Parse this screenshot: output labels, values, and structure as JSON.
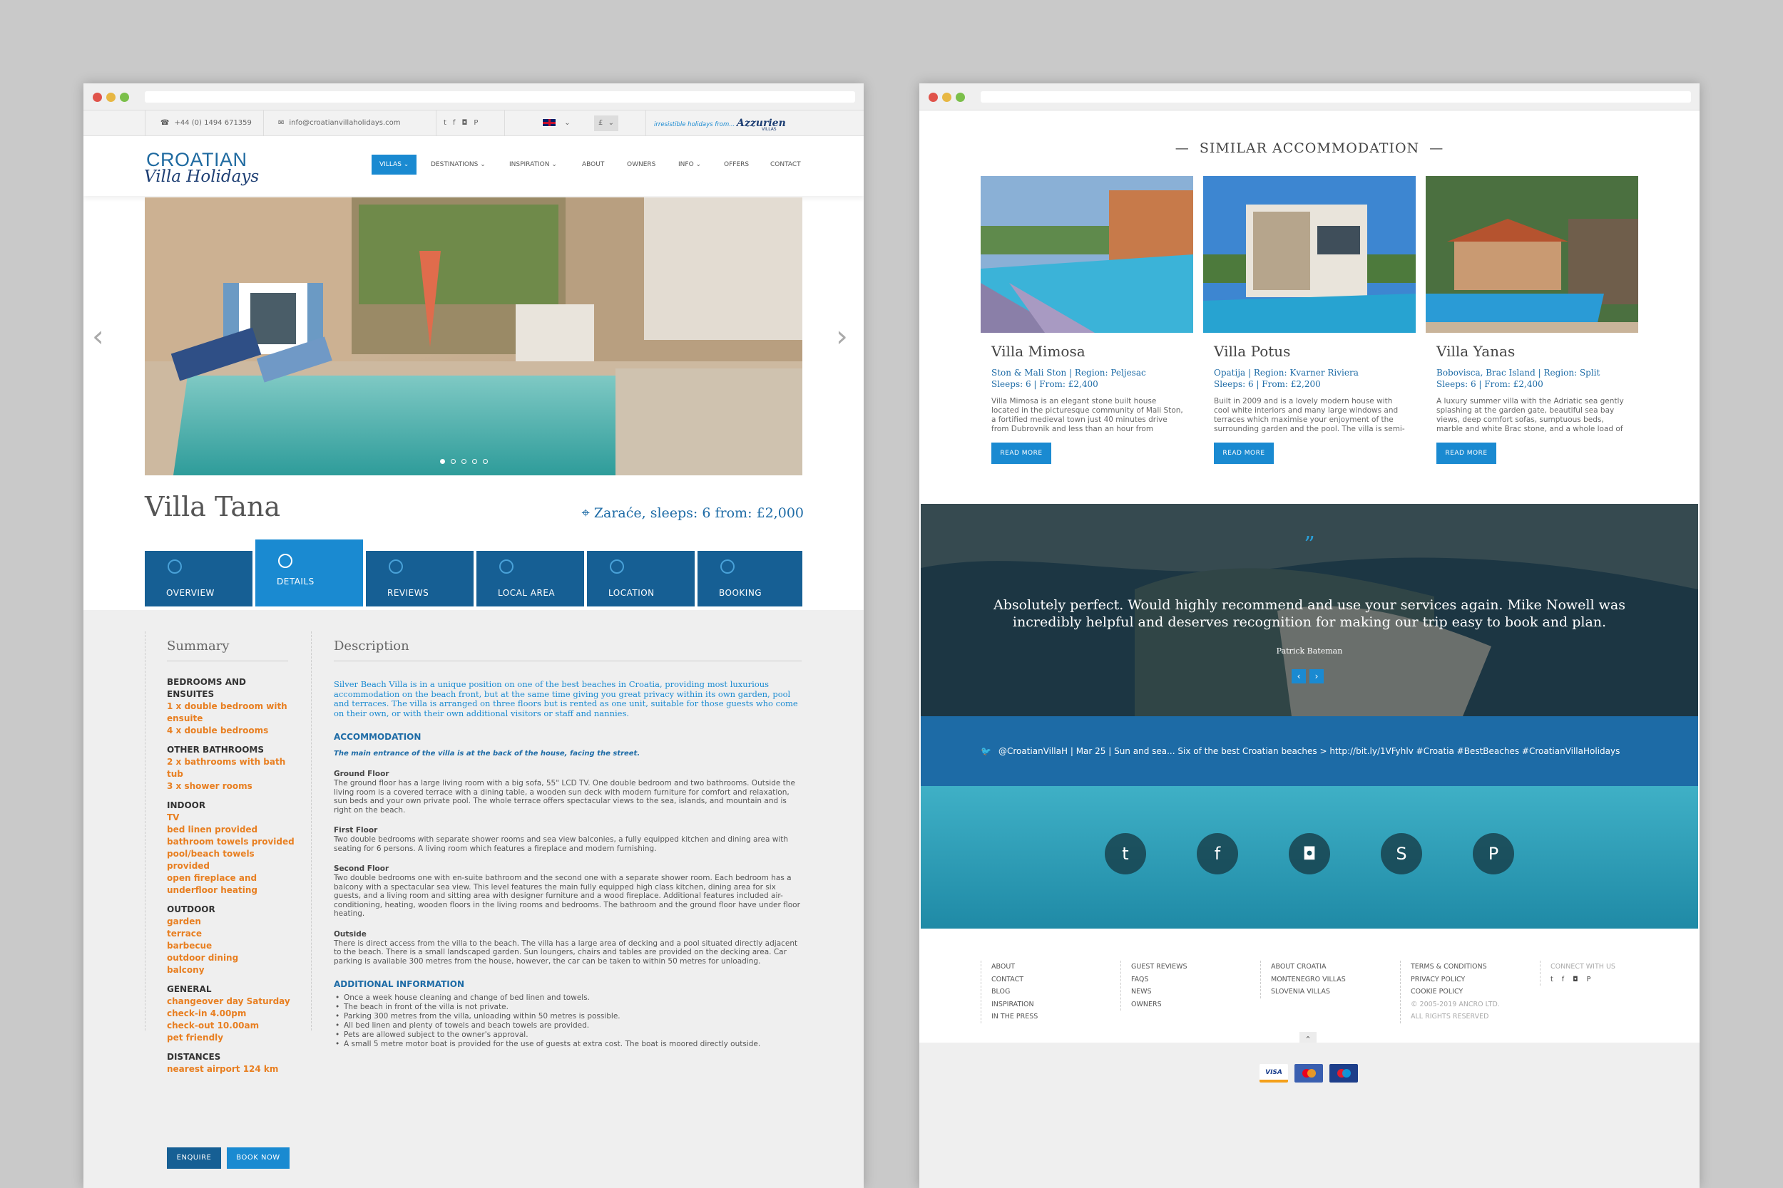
{
  "left": {
    "topbar": {
      "phone": "+44 (0) 1494 671359",
      "email": "info@croatianvillaholidays.com",
      "currency": "£",
      "partner_tagline": "irresistible holidays from...",
      "partner_name": "Azzurien",
      "partner_sub": "VILLAS"
    },
    "logo": {
      "line1": "CROATIAN",
      "line2": "Villa Holidays"
    },
    "nav": [
      "VILLAS",
      "DESTINATIONS",
      "INSPIRATION",
      "ABOUT",
      "OWNERS",
      "INFO",
      "OFFERS",
      "CONTACT"
    ],
    "villa": {
      "name": "Villa Tana",
      "location": "Zaraće, sleeps: 6 from: £2,000"
    },
    "tabs": [
      "OVERVIEW",
      "DETAILS",
      "REVIEWS",
      "LOCAL AREA",
      "LOCATION",
      "BOOKING"
    ],
    "summary": {
      "title": "Summary",
      "groups": [
        {
          "k": "BEDROOMS AND ENSUITES",
          "v": [
            "1 x double bedroom with ensuite",
            "4 x double bedrooms"
          ]
        },
        {
          "k": "OTHER BATHROOMS",
          "v": [
            "2 x bathrooms with bath tub",
            "3 x shower rooms"
          ]
        },
        {
          "k": "INDOOR",
          "v": [
            "TV",
            "bed linen provided",
            "bathroom towels provided",
            "pool/beach towels provided",
            "open fireplace and underfloor heating"
          ]
        },
        {
          "k": "OUTDOOR",
          "v": [
            "garden",
            "terrace",
            "barbecue",
            "outdoor dining",
            "balcony"
          ]
        },
        {
          "k": "GENERAL",
          "v": [
            "changeover day Saturday",
            "check-in 4.00pm",
            "check-out 10.00am",
            "pet friendly"
          ]
        },
        {
          "k": "DISTANCES",
          "v": [
            "nearest airport 124 km"
          ]
        }
      ],
      "enquire": "ENQUIRE",
      "book": "BOOK NOW"
    },
    "description": {
      "title": "Description",
      "intro": "Silver Beach Villa is in a unique position on one of the best beaches in Croatia, providing most luxurious accommodation on the beach front, but at the same time giving you great privacy within its own garden, pool and terraces. The villa is arranged on three floors but is rented as one unit, suitable for those guests who come on their own, or with their own additional visitors or staff and nannies.",
      "acc_title": "ACCOMMODATION",
      "acc_note": "The main entrance of the villa is at the back of the house, facing the street.",
      "floors": [
        {
          "label": "Ground Floor",
          "text": "The ground floor has a large living room with a big sofa, 55\" LCD TV. One double bedroom and two bathrooms. Outside the living room is a covered terrace with a dining table, a wooden sun deck with modern furniture for comfort and relaxation, sun beds and your own private pool. The whole terrace offers spectacular views to the sea, islands, and mountain and is right on the beach."
        },
        {
          "label": "First Floor",
          "text": "Two double bedrooms with separate shower rooms and sea view balconies, a fully equipped kitchen and dining area with seating for 6 persons. A living room which features a fireplace and modern furnishing."
        },
        {
          "label": "Second Floor",
          "text": "Two double bedrooms one with en-suite bathroom and the second one with a separate shower room. Each bedroom has a balcony with a spectacular sea view. This level features the main fully equipped high class kitchen, dining area for six guests, and a living room and sitting area with designer furniture and a wood fireplace. Additional features included air-conditioning, heating, wooden floors in the living rooms and bedrooms. The bathroom and the ground floor have under floor heating."
        },
        {
          "label": "Outside",
          "text": "There is direct access from the villa to the beach. The villa has a large area of decking and a pool situated directly adjacent to the beach. There is a small landscaped garden. Sun loungers, chairs and tables are provided on the decking area. Car parking is available 300 metres from the house, however, the car can be taken to within 50 metres for unloading."
        }
      ],
      "add_title": "ADDITIONAL INFORMATION",
      "add_items": [
        "Once a week house cleaning and change of bed linen and towels.",
        "The beach in front of the villa is not private.",
        "Parking 300 metres from the villa, unloading within 50 metres is possible.",
        "All bed linen and plenty of towels and beach towels are provided.",
        "Pets are allowed subject to the owner's approval.",
        "A small 5 metre motor boat is provided for the use of guests at extra cost. The boat is moored directly outside."
      ]
    }
  },
  "right": {
    "similar_title": "SIMILAR ACCOMMODATION",
    "cards": [
      {
        "name": "Villa Mimosa",
        "loc": "Ston & Mali Ston  |  Region: Peljesac",
        "info": "Sleeps: 6  |  From: £2,400",
        "desc": "Villa Mimosa is an elegant stone built house located in the picturesque community of Mali Ston, a fortified medieval town just 40 minutes drive from Dubrovnik and less than an hour from Dubrovnik airport. With the help of architects...",
        "btn": "READ MORE"
      },
      {
        "name": "Villa Potus",
        "loc": "Opatija  |  Region: Kvarner Riviera",
        "info": "Sleeps: 6  |  From: £2,200",
        "desc": "Built in 2009 and is a lovely modern house with cool white interiors and many large windows and terraces which maximise your enjoyment of the surrounding garden and the pool. The villa is semi-detached but offers privacy. Located in a hamlet...",
        "btn": "READ MORE"
      },
      {
        "name": "Villa Yanas",
        "loc": "Bobovisca, Brac Island  |  Region: Split",
        "info": "Sleeps: 6  |  From: £2,400",
        "desc": "A luxury summer villa with the Adriatic sea gently splashing at the garden gate, beautiful sea bay views, deep comfort sofas, sumptuous beds, marble and white Brac stone, and a whole load of other delicious things waiting for you in the...",
        "btn": "READ MORE"
      }
    ],
    "testimonial": {
      "quote": "Absolutely perfect. Would highly recommend and use your services again. Mike Nowell was incredibly helpful and deserves recognition for making our trip easy to book and plan.",
      "author": "Patrick Bateman"
    },
    "tweet": "@CroatianVillaH   |   Mar 25   |   Sun and sea... Six of the best Croatian beaches > http://bit.ly/1VFyhlv #Croatia #BestBeaches #CroatianVillaHolidays",
    "footer": {
      "col1": [
        "ABOUT",
        "CONTACT",
        "BLOG",
        "INSPIRATION",
        "IN THE PRESS"
      ],
      "col2": [
        "GUEST REVIEWS",
        "FAQS",
        "NEWS",
        "OWNERS"
      ],
      "col3": [
        "ABOUT CROATIA",
        "MONTENEGRO VILLAS",
        "SLOVENIA VILLAS"
      ],
      "col4": [
        "TERMS & CONDITIONS",
        "PRIVACY POLICY",
        "COOKIE POLICY"
      ],
      "copyright1": "© 2005-2019 ANCRO LTD.",
      "copyright2": "ALL RIGHTS RESERVED",
      "connect": "CONNECT WITH US"
    },
    "payments": {
      "visa": "VISA"
    }
  }
}
